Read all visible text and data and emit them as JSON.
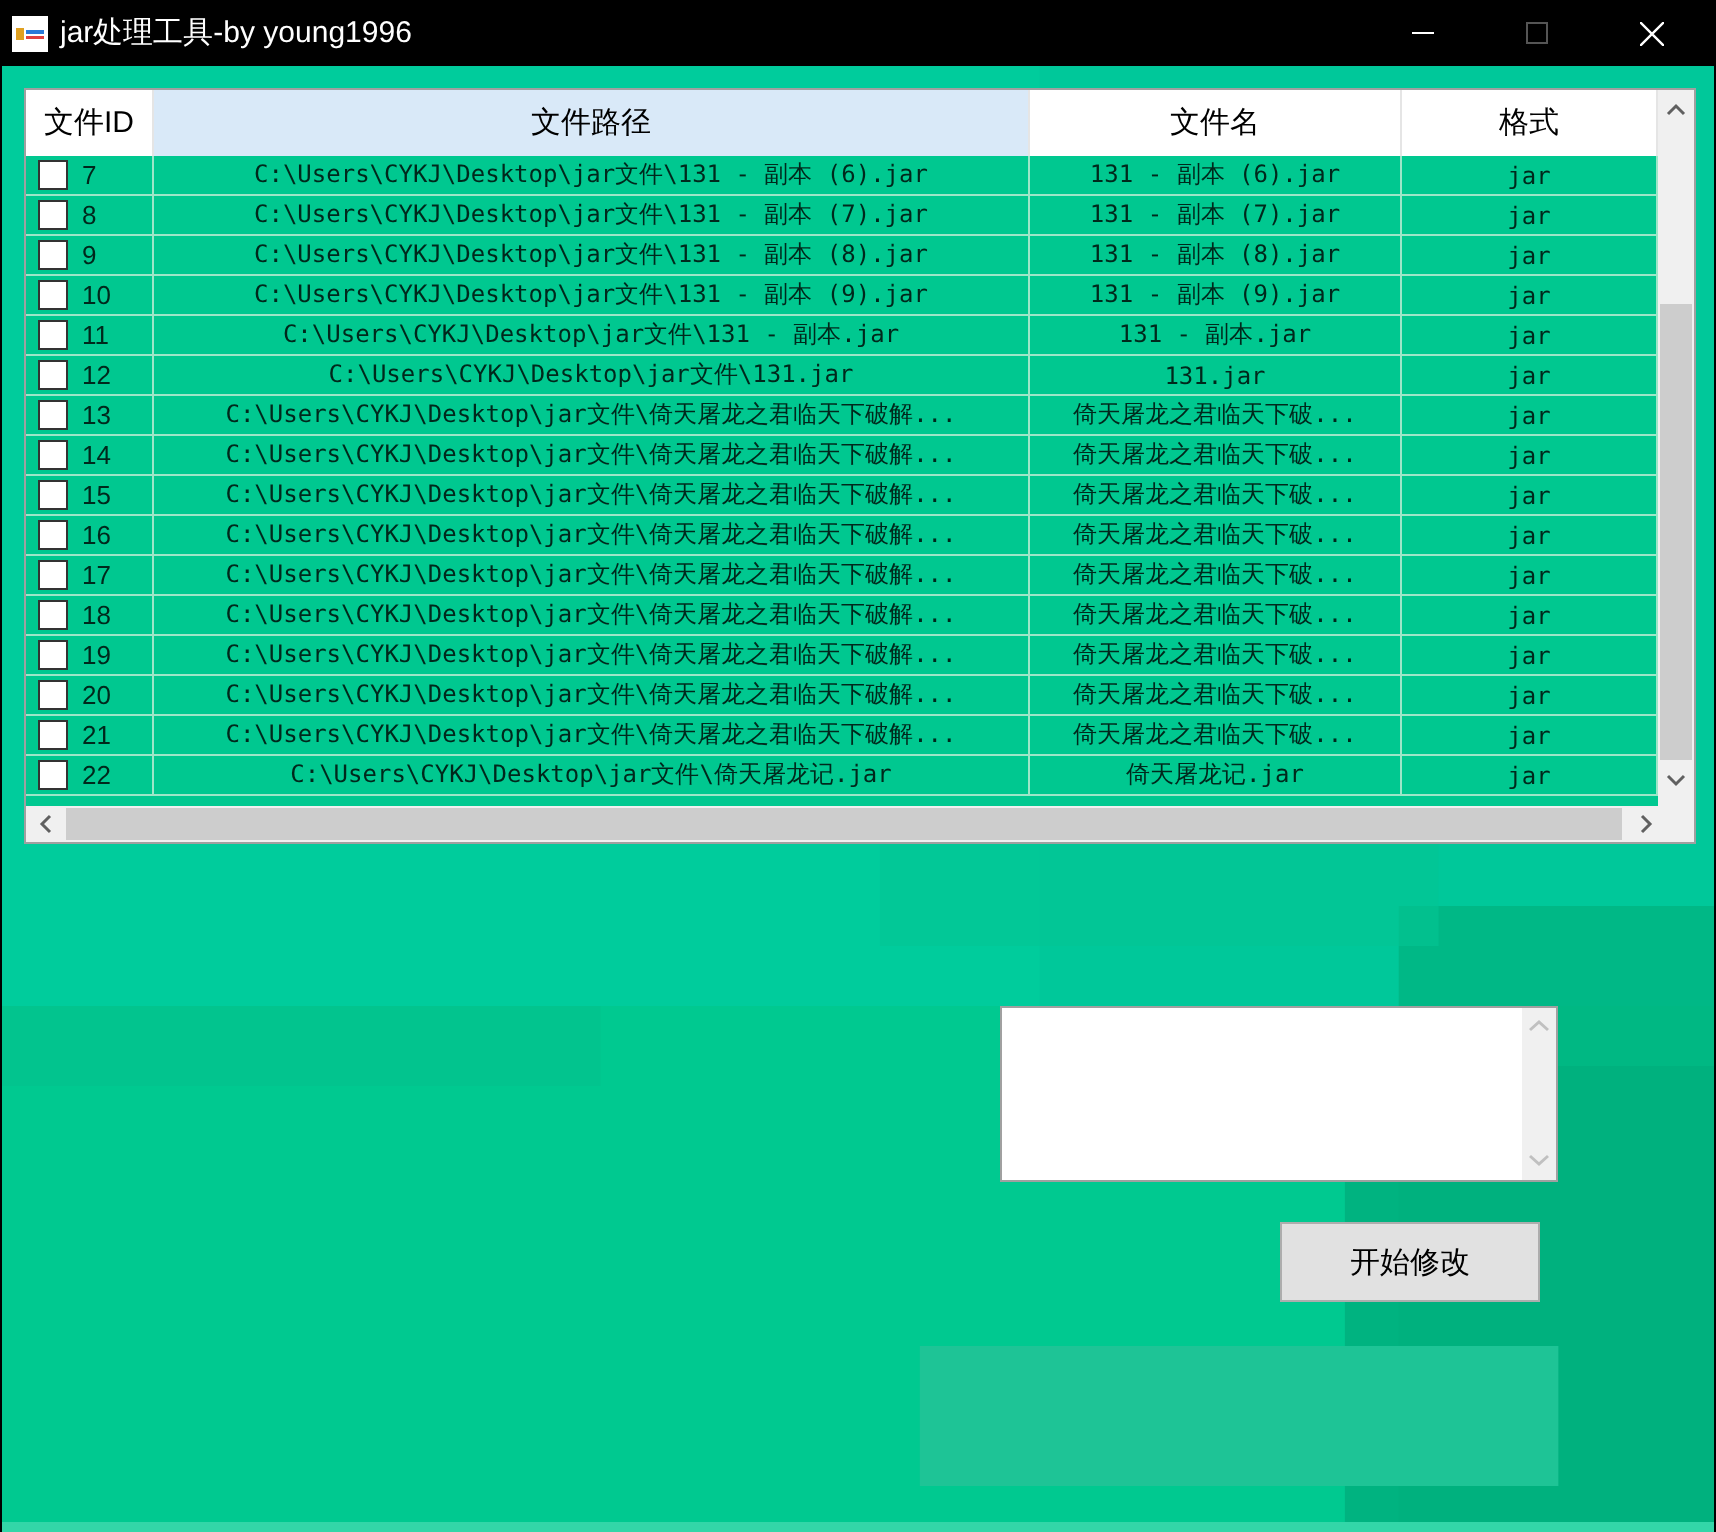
{
  "window": {
    "title": "jar处理工具-by young1996"
  },
  "table": {
    "columns": [
      {
        "label": "文件ID",
        "selected": false
      },
      {
        "label": "文件路径",
        "selected": true
      },
      {
        "label": "文件名",
        "selected": false
      },
      {
        "label": "格式",
        "selected": false
      }
    ],
    "rows": [
      {
        "id": "7",
        "checked": false,
        "path": "C:\\Users\\CYKJ\\Desktop\\jar文件\\131 - 副本 (6).jar",
        "name": "131 - 副本 (6).jar",
        "format": "jar"
      },
      {
        "id": "8",
        "checked": false,
        "path": "C:\\Users\\CYKJ\\Desktop\\jar文件\\131 - 副本 (7).jar",
        "name": "131 - 副本 (7).jar",
        "format": "jar"
      },
      {
        "id": "9",
        "checked": false,
        "path": "C:\\Users\\CYKJ\\Desktop\\jar文件\\131 - 副本 (8).jar",
        "name": "131 - 副本 (8).jar",
        "format": "jar"
      },
      {
        "id": "10",
        "checked": false,
        "path": "C:\\Users\\CYKJ\\Desktop\\jar文件\\131 - 副本 (9).jar",
        "name": "131 - 副本 (9).jar",
        "format": "jar"
      },
      {
        "id": "11",
        "checked": false,
        "path": "C:\\Users\\CYKJ\\Desktop\\jar文件\\131 - 副本.jar",
        "name": "131 - 副本.jar",
        "format": "jar"
      },
      {
        "id": "12",
        "checked": false,
        "path": "C:\\Users\\CYKJ\\Desktop\\jar文件\\131.jar",
        "name": "131.jar",
        "format": "jar"
      },
      {
        "id": "13",
        "checked": false,
        "path": "C:\\Users\\CYKJ\\Desktop\\jar文件\\倚天屠龙之君临天下破解...",
        "name": "倚天屠龙之君临天下破...",
        "format": "jar"
      },
      {
        "id": "14",
        "checked": false,
        "path": "C:\\Users\\CYKJ\\Desktop\\jar文件\\倚天屠龙之君临天下破解...",
        "name": "倚天屠龙之君临天下破...",
        "format": "jar"
      },
      {
        "id": "15",
        "checked": false,
        "path": "C:\\Users\\CYKJ\\Desktop\\jar文件\\倚天屠龙之君临天下破解...",
        "name": "倚天屠龙之君临天下破...",
        "format": "jar"
      },
      {
        "id": "16",
        "checked": false,
        "path": "C:\\Users\\CYKJ\\Desktop\\jar文件\\倚天屠龙之君临天下破解...",
        "name": "倚天屠龙之君临天下破...",
        "format": "jar"
      },
      {
        "id": "17",
        "checked": false,
        "path": "C:\\Users\\CYKJ\\Desktop\\jar文件\\倚天屠龙之君临天下破解...",
        "name": "倚天屠龙之君临天下破...",
        "format": "jar"
      },
      {
        "id": "18",
        "checked": false,
        "path": "C:\\Users\\CYKJ\\Desktop\\jar文件\\倚天屠龙之君临天下破解...",
        "name": "倚天屠龙之君临天下破...",
        "format": "jar"
      },
      {
        "id": "19",
        "checked": false,
        "path": "C:\\Users\\CYKJ\\Desktop\\jar文件\\倚天屠龙之君临天下破解...",
        "name": "倚天屠龙之君临天下破...",
        "format": "jar"
      },
      {
        "id": "20",
        "checked": false,
        "path": "C:\\Users\\CYKJ\\Desktop\\jar文件\\倚天屠龙之君临天下破解...",
        "name": "倚天屠龙之君临天下破...",
        "format": "jar"
      },
      {
        "id": "21",
        "checked": false,
        "path": "C:\\Users\\CYKJ\\Desktop\\jar文件\\倚天屠龙之君临天下破解...",
        "name": "倚天屠龙之君临天下破...",
        "format": "jar"
      },
      {
        "id": "22",
        "checked": false,
        "path": "C:\\Users\\CYKJ\\Desktop\\jar文件\\倚天屠龙记.jar",
        "name": "倚天屠龙记.jar",
        "format": "jar"
      }
    ]
  },
  "start_button": {
    "label": "开始修改"
  }
}
